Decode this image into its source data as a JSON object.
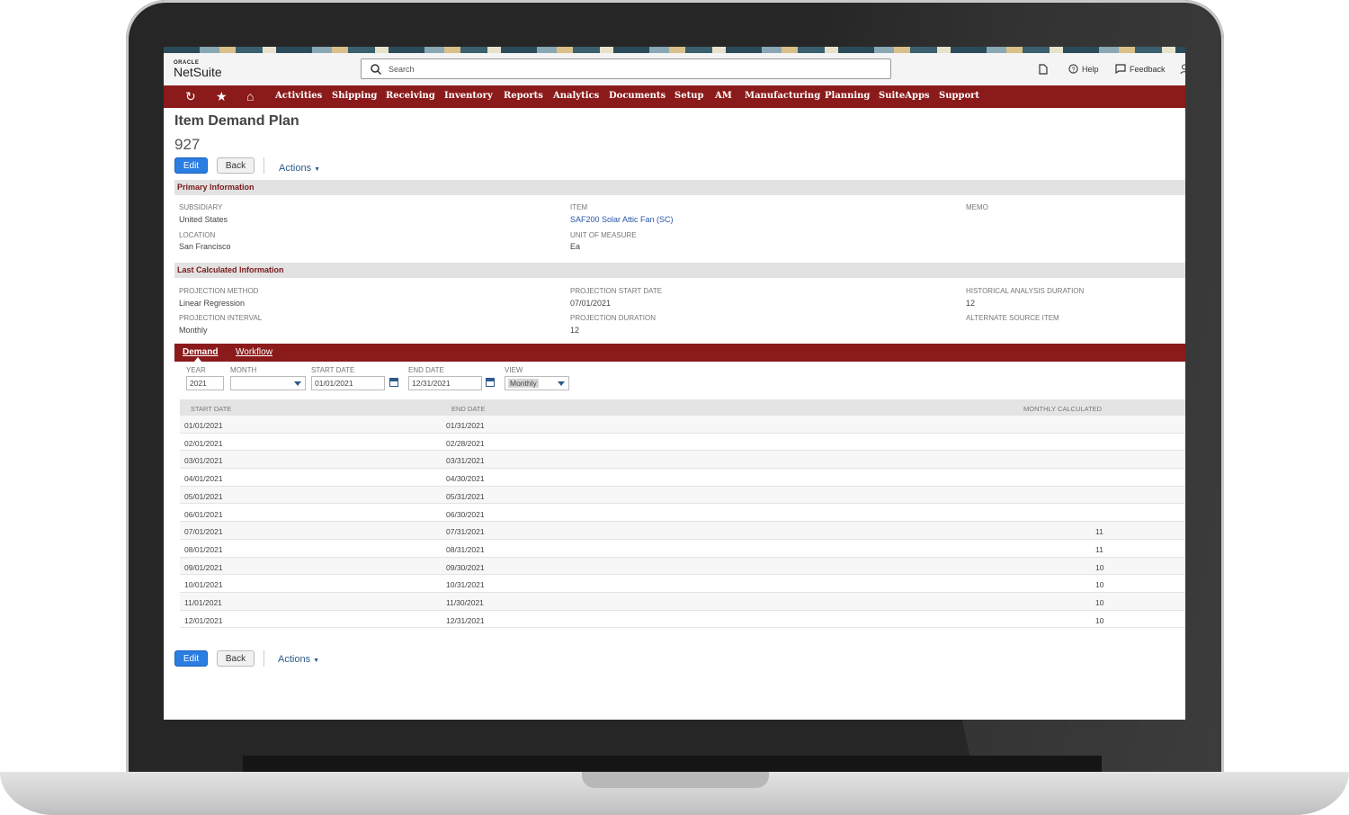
{
  "header": {
    "logo_top": "ORACLE",
    "logo_bottom": "NetSuite",
    "search_placeholder": "Search",
    "help": "Help",
    "feedback": "Feedback"
  },
  "nav": [
    "Activities",
    "Shipping",
    "Receiving",
    "Inventory",
    "Reports",
    "Analytics",
    "Documents",
    "Setup",
    "AM",
    "Manufacturing",
    "Planning",
    "SuiteApps",
    "Support"
  ],
  "page": {
    "title": "Item Demand Plan",
    "record_number": "927",
    "edit": "Edit",
    "back": "Back",
    "actions": "Actions"
  },
  "primary": {
    "section_title": "Primary Information",
    "subsidiary_label": "SUBSIDIARY",
    "subsidiary": "United States",
    "location_label": "LOCATION",
    "location": "San Francisco",
    "item_label": "ITEM",
    "item": "SAF200 Solar Attic Fan (SC)",
    "uom_label": "UNIT OF MEASURE",
    "uom": "Ea",
    "memo_label": "MEMO"
  },
  "last_calc": {
    "section_title": "Last Calculated Information",
    "method_label": "PROJECTION METHOD",
    "method": "Linear Regression",
    "interval_label": "PROJECTION INTERVAL",
    "interval": "Monthly",
    "start_label": "PROJECTION START DATE",
    "start": "07/01/2021",
    "duration_label": "PROJECTION DURATION",
    "duration": "12",
    "hist_label": "HISTORICAL ANALYSIS DURATION",
    "hist": "12",
    "alt_label": "ALTERNATE SOURCE ITEM"
  },
  "tabs": {
    "demand": "Demand",
    "workflow": "Workflow"
  },
  "filters": {
    "year_label": "YEAR",
    "year": "2021",
    "month_label": "MONTH",
    "month": "",
    "start_label": "START DATE",
    "start": "01/01/2021",
    "end_label": "END DATE",
    "end": "12/31/2021",
    "view_label": "VIEW",
    "view": "Monthly"
  },
  "table": {
    "headers": [
      "START DATE",
      "END DATE",
      "MONTHLY CALCULATED"
    ],
    "rows": [
      [
        "01/01/2021",
        "01/31/2021",
        ""
      ],
      [
        "02/01/2021",
        "02/28/2021",
        ""
      ],
      [
        "03/01/2021",
        "03/31/2021",
        ""
      ],
      [
        "04/01/2021",
        "04/30/2021",
        ""
      ],
      [
        "05/01/2021",
        "05/31/2021",
        ""
      ],
      [
        "06/01/2021",
        "06/30/2021",
        ""
      ],
      [
        "07/01/2021",
        "07/31/2021",
        "11"
      ],
      [
        "08/01/2021",
        "08/31/2021",
        "11"
      ],
      [
        "09/01/2021",
        "09/30/2021",
        "10"
      ],
      [
        "10/01/2021",
        "10/31/2021",
        "10"
      ],
      [
        "11/01/2021",
        "11/30/2021",
        "10"
      ],
      [
        "12/01/2021",
        "12/31/2021",
        "10"
      ]
    ]
  }
}
